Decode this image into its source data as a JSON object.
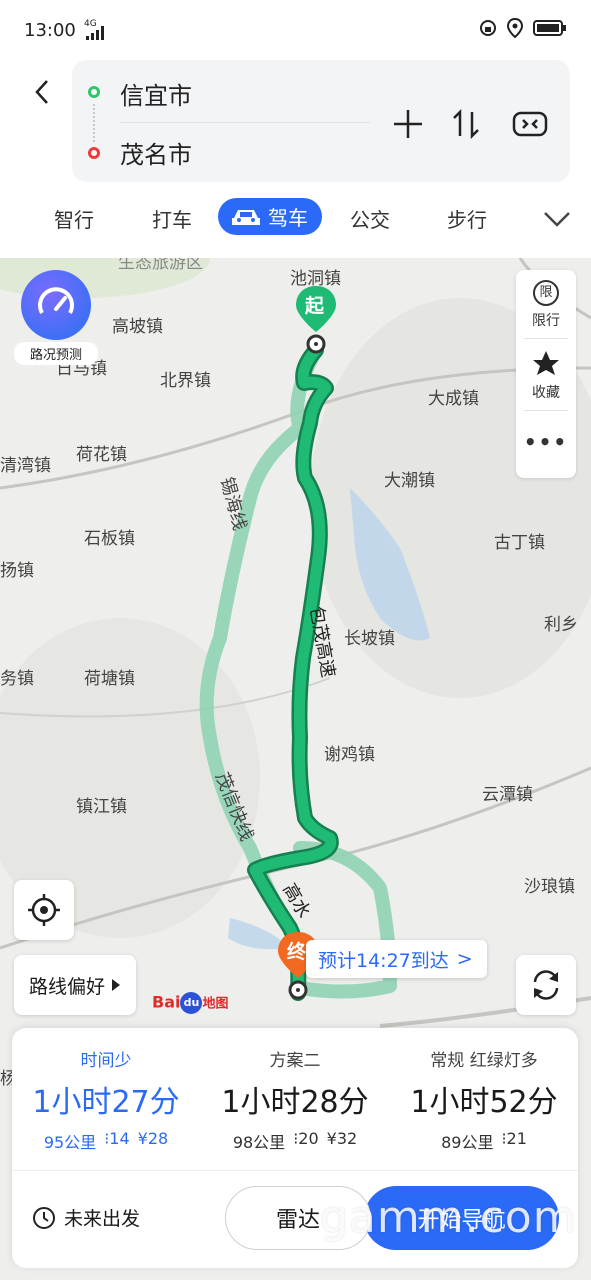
{
  "status_bar": {
    "time": "13:00",
    "network": "4G"
  },
  "route": {
    "origin": "信宜市",
    "destination": "茂名市"
  },
  "tabs": [
    {
      "label": "智行"
    },
    {
      "label": "打车"
    },
    {
      "label": "驾车"
    },
    {
      "label": "公交"
    },
    {
      "label": "步行"
    }
  ],
  "map": {
    "places": [
      "生态旅游区",
      "池洞镇",
      "高坡镇",
      "日马镇",
      "北界镇",
      "大成镇",
      "清湾镇",
      "荷花镇",
      "大潮镇",
      "石板镇",
      "古丁镇",
      "扬镇",
      "长坡镇",
      "利乡",
      "务镇",
      "荷塘镇",
      "谢鸡镇",
      "镇江镇",
      "云潭镇",
      "沙琅镇",
      "杨"
    ],
    "roads": [
      "锡海线",
      "包茂高速",
      "茂信快线",
      "高水"
    ],
    "speed_widget_label": "路况预测",
    "side_panel": {
      "restriction": "限行",
      "restriction_icon_text": "限",
      "favorite": "收藏",
      "more": "•••"
    },
    "route_preference": "路线偏好",
    "start_marker": "起",
    "end_marker": "终",
    "eta": "预计14:27到达",
    "logo": {
      "bai": "Bai",
      "du": "du",
      "name": "地图"
    }
  },
  "plans": [
    {
      "tag": "时间少",
      "duration": "1小时27分",
      "distance": "95公里",
      "lights": "14",
      "toll": "¥28",
      "selected": true
    },
    {
      "tag": "方案二",
      "duration": "1小时28分",
      "distance": "98公里",
      "lights": "20",
      "toll": "¥32",
      "selected": false
    },
    {
      "tag": "常规  红绿灯多",
      "duration": "1小时52分",
      "distance": "89公里",
      "lights": "21",
      "toll": "",
      "selected": false
    }
  ],
  "actions": {
    "future": "未来出发",
    "radar": "雷达",
    "start": "开始导航"
  },
  "watermark": "gamm.com",
  "colors": {
    "accent": "#2b6af6",
    "route_main": "#1fba74",
    "route_alt": "#8fd3b4",
    "origin_dot": "#30c46b",
    "dest_dot": "#ee3b3b",
    "end_marker": "#f26a21"
  }
}
